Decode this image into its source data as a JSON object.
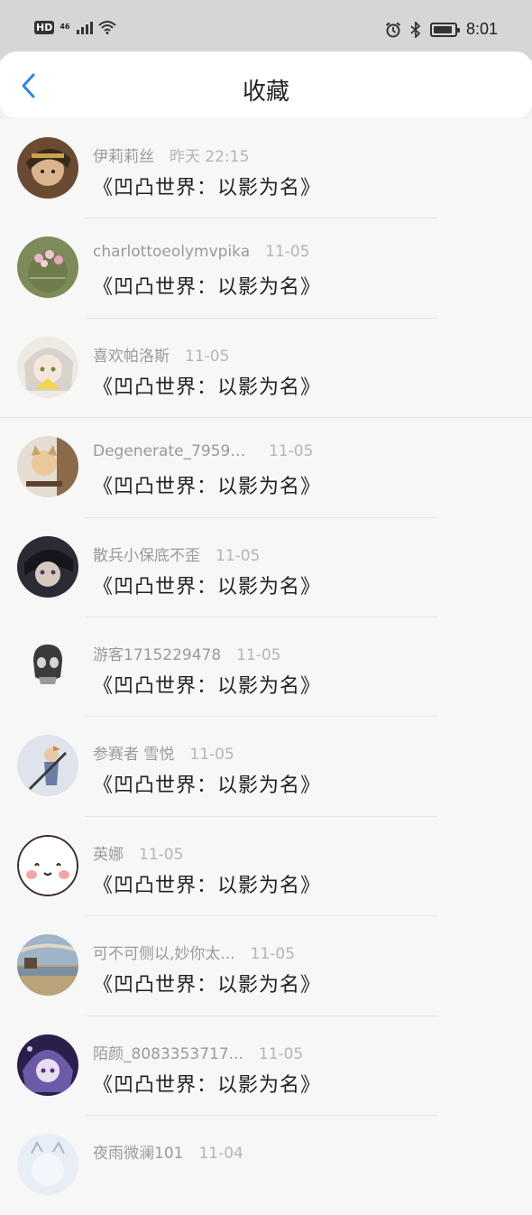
{
  "status_bar": {
    "hd": "HD",
    "network": "46",
    "time": "8:01",
    "battery_level": 0.9
  },
  "header": {
    "title": "收藏",
    "back_icon": "chevron-left-icon",
    "accent_color": "#2e86de"
  },
  "items": [
    {
      "name": "伊莉莉丝",
      "time": "昨天 22:15",
      "title": "《凹凸世界：以影为名》"
    },
    {
      "name": "charlottoeolymvpika",
      "time": "11-05",
      "title": "《凹凸世界：以影为名》"
    },
    {
      "name": "喜欢帕洛斯",
      "time": "11-05",
      "title": "《凹凸世界：以影为名》"
    },
    {
      "name": "Degenerate_79599...",
      "time": "11-05",
      "title": "《凹凸世界：以影为名》"
    },
    {
      "name": "散兵小保底不歪",
      "time": "11-05",
      "title": "《凹凸世界：以影为名》"
    },
    {
      "name": "游客1715229478",
      "time": "11-05",
      "title": "《凹凸世界：以影为名》"
    },
    {
      "name": "参赛者 雪悦",
      "time": "11-05",
      "title": "《凹凸世界：以影为名》"
    },
    {
      "name": "英娜",
      "time": "11-05",
      "title": "《凹凸世界：以影为名》"
    },
    {
      "name": "可不可侧以,妙你太...",
      "time": "11-05",
      "title": "《凹凸世界：以影为名》"
    },
    {
      "name": "陌颜_8083353717...",
      "time": "11-05",
      "title": "《凹凸世界：以影为名》"
    },
    {
      "name": "夜雨微澜101",
      "time": "11-04",
      "title": ""
    }
  ]
}
